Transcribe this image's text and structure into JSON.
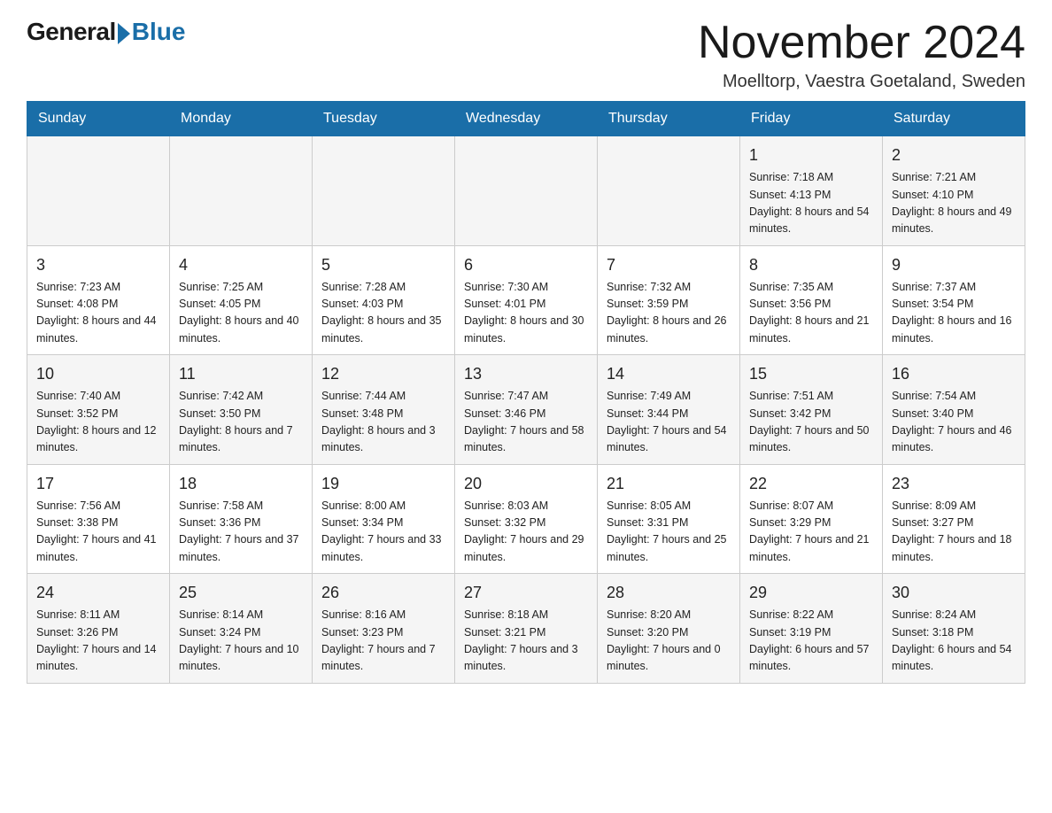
{
  "logo": {
    "general": "General",
    "blue": "Blue"
  },
  "title": "November 2024",
  "location": "Moelltorp, Vaestra Goetaland, Sweden",
  "weekdays": [
    "Sunday",
    "Monday",
    "Tuesday",
    "Wednesday",
    "Thursday",
    "Friday",
    "Saturday"
  ],
  "weeks": [
    [
      {
        "day": "",
        "info": ""
      },
      {
        "day": "",
        "info": ""
      },
      {
        "day": "",
        "info": ""
      },
      {
        "day": "",
        "info": ""
      },
      {
        "day": "",
        "info": ""
      },
      {
        "day": "1",
        "info": "Sunrise: 7:18 AM\nSunset: 4:13 PM\nDaylight: 8 hours\nand 54 minutes."
      },
      {
        "day": "2",
        "info": "Sunrise: 7:21 AM\nSunset: 4:10 PM\nDaylight: 8 hours\nand 49 minutes."
      }
    ],
    [
      {
        "day": "3",
        "info": "Sunrise: 7:23 AM\nSunset: 4:08 PM\nDaylight: 8 hours\nand 44 minutes."
      },
      {
        "day": "4",
        "info": "Sunrise: 7:25 AM\nSunset: 4:05 PM\nDaylight: 8 hours\nand 40 minutes."
      },
      {
        "day": "5",
        "info": "Sunrise: 7:28 AM\nSunset: 4:03 PM\nDaylight: 8 hours\nand 35 minutes."
      },
      {
        "day": "6",
        "info": "Sunrise: 7:30 AM\nSunset: 4:01 PM\nDaylight: 8 hours\nand 30 minutes."
      },
      {
        "day": "7",
        "info": "Sunrise: 7:32 AM\nSunset: 3:59 PM\nDaylight: 8 hours\nand 26 minutes."
      },
      {
        "day": "8",
        "info": "Sunrise: 7:35 AM\nSunset: 3:56 PM\nDaylight: 8 hours\nand 21 minutes."
      },
      {
        "day": "9",
        "info": "Sunrise: 7:37 AM\nSunset: 3:54 PM\nDaylight: 8 hours\nand 16 minutes."
      }
    ],
    [
      {
        "day": "10",
        "info": "Sunrise: 7:40 AM\nSunset: 3:52 PM\nDaylight: 8 hours\nand 12 minutes."
      },
      {
        "day": "11",
        "info": "Sunrise: 7:42 AM\nSunset: 3:50 PM\nDaylight: 8 hours\nand 7 minutes."
      },
      {
        "day": "12",
        "info": "Sunrise: 7:44 AM\nSunset: 3:48 PM\nDaylight: 8 hours\nand 3 minutes."
      },
      {
        "day": "13",
        "info": "Sunrise: 7:47 AM\nSunset: 3:46 PM\nDaylight: 7 hours\nand 58 minutes."
      },
      {
        "day": "14",
        "info": "Sunrise: 7:49 AM\nSunset: 3:44 PM\nDaylight: 7 hours\nand 54 minutes."
      },
      {
        "day": "15",
        "info": "Sunrise: 7:51 AM\nSunset: 3:42 PM\nDaylight: 7 hours\nand 50 minutes."
      },
      {
        "day": "16",
        "info": "Sunrise: 7:54 AM\nSunset: 3:40 PM\nDaylight: 7 hours\nand 46 minutes."
      }
    ],
    [
      {
        "day": "17",
        "info": "Sunrise: 7:56 AM\nSunset: 3:38 PM\nDaylight: 7 hours\nand 41 minutes."
      },
      {
        "day": "18",
        "info": "Sunrise: 7:58 AM\nSunset: 3:36 PM\nDaylight: 7 hours\nand 37 minutes."
      },
      {
        "day": "19",
        "info": "Sunrise: 8:00 AM\nSunset: 3:34 PM\nDaylight: 7 hours\nand 33 minutes."
      },
      {
        "day": "20",
        "info": "Sunrise: 8:03 AM\nSunset: 3:32 PM\nDaylight: 7 hours\nand 29 minutes."
      },
      {
        "day": "21",
        "info": "Sunrise: 8:05 AM\nSunset: 3:31 PM\nDaylight: 7 hours\nand 25 minutes."
      },
      {
        "day": "22",
        "info": "Sunrise: 8:07 AM\nSunset: 3:29 PM\nDaylight: 7 hours\nand 21 minutes."
      },
      {
        "day": "23",
        "info": "Sunrise: 8:09 AM\nSunset: 3:27 PM\nDaylight: 7 hours\nand 18 minutes."
      }
    ],
    [
      {
        "day": "24",
        "info": "Sunrise: 8:11 AM\nSunset: 3:26 PM\nDaylight: 7 hours\nand 14 minutes."
      },
      {
        "day": "25",
        "info": "Sunrise: 8:14 AM\nSunset: 3:24 PM\nDaylight: 7 hours\nand 10 minutes."
      },
      {
        "day": "26",
        "info": "Sunrise: 8:16 AM\nSunset: 3:23 PM\nDaylight: 7 hours\nand 7 minutes."
      },
      {
        "day": "27",
        "info": "Sunrise: 8:18 AM\nSunset: 3:21 PM\nDaylight: 7 hours\nand 3 minutes."
      },
      {
        "day": "28",
        "info": "Sunrise: 8:20 AM\nSunset: 3:20 PM\nDaylight: 7 hours\nand 0 minutes."
      },
      {
        "day": "29",
        "info": "Sunrise: 8:22 AM\nSunset: 3:19 PM\nDaylight: 6 hours\nand 57 minutes."
      },
      {
        "day": "30",
        "info": "Sunrise: 8:24 AM\nSunset: 3:18 PM\nDaylight: 6 hours\nand 54 minutes."
      }
    ]
  ]
}
